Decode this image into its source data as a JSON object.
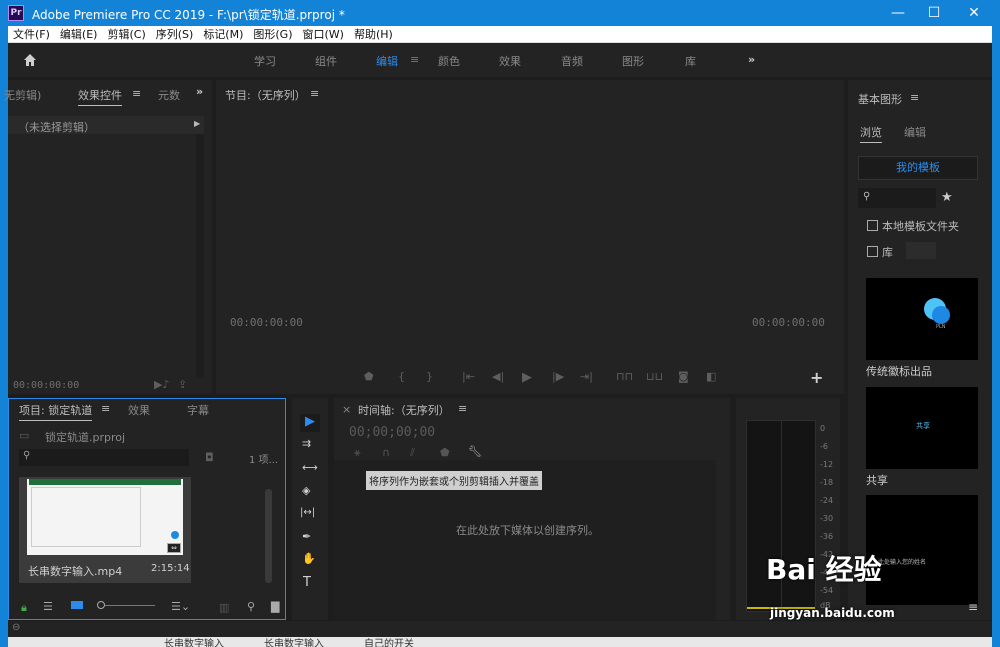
{
  "window": {
    "app_icon": "Pr",
    "title": "Adobe Premiere Pro CC 2019 - F:\\pr\\锁定轨道.prproj *",
    "minimize": "—",
    "maximize": "☐",
    "close": "✕"
  },
  "menu": [
    "文件(F)",
    "编辑(E)",
    "剪辑(C)",
    "序列(S)",
    "标记(M)",
    "图形(G)",
    "窗口(W)",
    "帮助(H)"
  ],
  "workspaces": {
    "items": [
      "学习",
      "组件",
      "编辑",
      "颜色",
      "效果",
      "音频",
      "图形",
      "库"
    ],
    "active": "编辑",
    "more": "»",
    "active_menu": "≡"
  },
  "source_panel": {
    "tabs": [
      "无剪辑)",
      "效果控件",
      "元数"
    ],
    "active_menu": "≡",
    "overflow": "»",
    "no_clip": "（未选择剪辑）",
    "timecode": "00:00:00:00"
  },
  "program_monitor": {
    "title": "节目:（无序列）",
    "menu": "≡",
    "timecode_left": "00:00:00:00",
    "timecode_right": "00:00:00:00",
    "add": "+"
  },
  "project_panel": {
    "tabs": [
      "项目: 锁定轨道",
      "效果",
      "字幕"
    ],
    "menu": "≡",
    "file": "锁定轨道.prproj",
    "item_count": "1 项...",
    "clip_name": "长串数字输入.mp4",
    "clip_duration": "2:15:14"
  },
  "tools": [
    "▶",
    "⇉",
    "⟷",
    "◈",
    "|↔|",
    "✒",
    "✋",
    "T"
  ],
  "timeline": {
    "close": "×",
    "title": "时间轴:（无序列）",
    "menu": "≡",
    "timecode": "00;00;00;00",
    "tooltip": "将序列作为嵌套或个别剪辑插入并覆盖",
    "drop_hint": "在此处放下媒体以创建序列。"
  },
  "audio_meter": {
    "ticks": [
      "0",
      "-6",
      "-12",
      "-18",
      "-24",
      "-30",
      "-36",
      "-42",
      "-48",
      "-54",
      "dB"
    ]
  },
  "essential_graphics": {
    "title": "基本图形",
    "menu": "≡",
    "tabs": [
      "浏览",
      "编辑"
    ],
    "my_templates": "我的模板",
    "star": "★",
    "local_folder": "本地模板文件夹",
    "library": "库",
    "templates": [
      {
        "name": "传统徽标出品",
        "thumb_text": "PLN"
      },
      {
        "name": "共享",
        "thumb_text": "共享"
      },
      {
        "name": "",
        "thumb_text": "此处输入您的姓名"
      }
    ],
    "bottom_menu": "≡"
  },
  "watermark": {
    "logo": "Bai 经验",
    "url": "jingyan.baidu.com"
  },
  "background_text": [
    "长串数字输入",
    "长串数字输入",
    "自己的开关"
  ],
  "colors": {
    "accent": "#2d8ceb",
    "titlebar": "#1383d7",
    "panel": "#232323",
    "active_border": "#2d8ceb"
  }
}
